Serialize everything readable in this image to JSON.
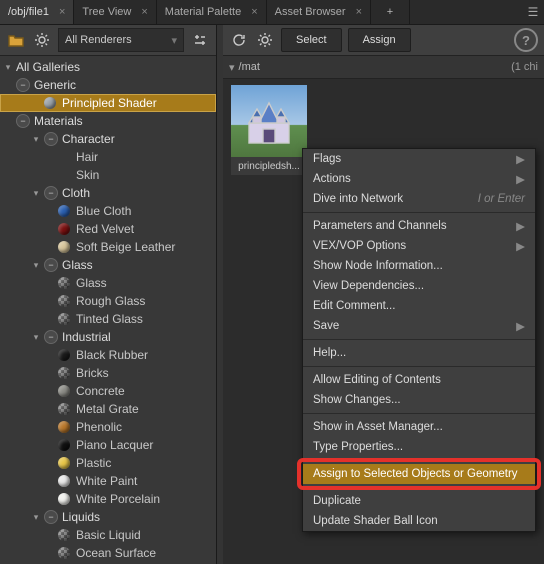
{
  "tabs": [
    {
      "label": "/obj/file1",
      "active": true
    },
    {
      "label": "Tree View",
      "active": false
    },
    {
      "label": "Material Palette",
      "active": false
    },
    {
      "label": "Asset Browser",
      "active": false
    }
  ],
  "left_toolbar": {
    "renderers_label": "All Renderers"
  },
  "tree": {
    "root": "All Galleries",
    "generic": {
      "label": "Generic",
      "children": [
        {
          "label": "Principled Shader",
          "selected": true,
          "swatch": "#9aa2a8"
        }
      ]
    },
    "materials": "Materials",
    "groups": [
      {
        "label": "Character",
        "items": [
          {
            "label": "Hair",
            "swatch": null
          },
          {
            "label": "Skin",
            "swatch": null
          }
        ]
      },
      {
        "label": "Cloth",
        "items": [
          {
            "label": "Blue Cloth",
            "swatch": "#2a5fb0"
          },
          {
            "label": "Red Velvet",
            "swatch": "#7a1010"
          },
          {
            "label": "Soft Beige Leather",
            "swatch": "#d7c59a"
          }
        ]
      },
      {
        "label": "Glass",
        "items": [
          {
            "label": "Glass",
            "swatch": "tex"
          },
          {
            "label": "Rough Glass",
            "swatch": "tex"
          },
          {
            "label": "Tinted Glass",
            "swatch": "tex"
          }
        ]
      },
      {
        "label": "Industrial",
        "items": [
          {
            "label": "Black Rubber",
            "swatch": "#1a1a1a"
          },
          {
            "label": "Bricks",
            "swatch": "tex"
          },
          {
            "label": "Concrete",
            "swatch": "#8c8c86"
          },
          {
            "label": "Metal Grate",
            "swatch": "tex"
          },
          {
            "label": "Phenolic",
            "swatch": "#b9772a"
          },
          {
            "label": "Piano Lacquer",
            "swatch": "#101010"
          },
          {
            "label": "Plastic",
            "swatch": "#e8c648"
          },
          {
            "label": "White Paint",
            "swatch": "#e8e8e8"
          },
          {
            "label": "White Porcelain",
            "swatch": "#f2f2ee"
          }
        ]
      },
      {
        "label": "Liquids",
        "items": [
          {
            "label": "Basic Liquid",
            "swatch": "tex"
          },
          {
            "label": "Ocean Surface",
            "swatch": "tex"
          }
        ]
      }
    ]
  },
  "right_toolbar": {
    "select_label": "Select",
    "assign_label": "Assign"
  },
  "pathbar": {
    "path": "/mat",
    "count": "(1 chi"
  },
  "thumbnail": {
    "caption": "principledsh..."
  },
  "menu": {
    "items": [
      {
        "label": "Flags",
        "sub": true
      },
      {
        "label": "Actions",
        "sub": true
      },
      {
        "label": "Dive into Network",
        "hint": "I or Enter"
      },
      {
        "sep": true
      },
      {
        "label": "Parameters and Channels",
        "sub": true
      },
      {
        "label": "VEX/VOP Options",
        "sub": true
      },
      {
        "label": "Show Node Information..."
      },
      {
        "label": "View Dependencies..."
      },
      {
        "label": "Edit Comment..."
      },
      {
        "label": "Save",
        "sub": true
      },
      {
        "sep": true
      },
      {
        "label": "Help..."
      },
      {
        "sep": true
      },
      {
        "label": "Allow Editing of Contents"
      },
      {
        "label": "Show Changes..."
      },
      {
        "sep": true
      },
      {
        "label": "Show in Asset Manager..."
      },
      {
        "label": "Type Properties..."
      },
      {
        "sep": true
      },
      {
        "label": "Assign to Selected Objects or Geometry",
        "highlight": true
      },
      {
        "sep": true
      },
      {
        "label": "Duplicate"
      },
      {
        "label": "Update Shader Ball Icon"
      }
    ]
  }
}
